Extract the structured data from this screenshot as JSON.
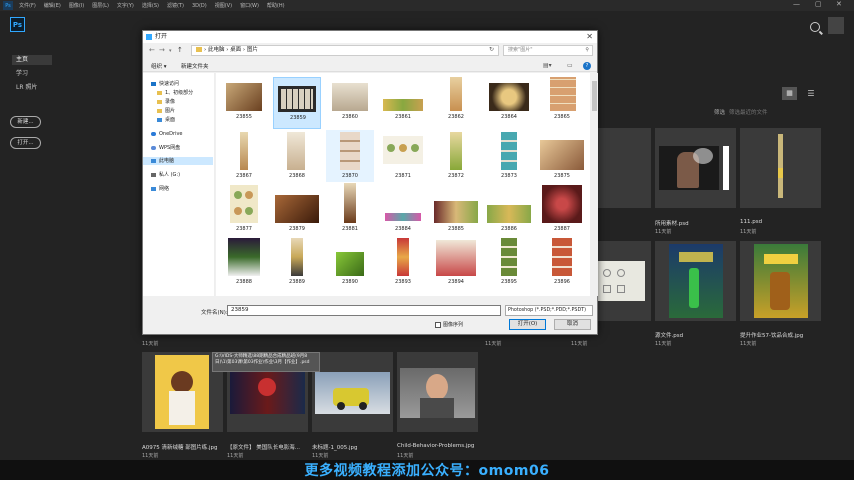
{
  "menubar": {
    "app_icon": "Ps",
    "items": [
      "文件(F)",
      "编辑(E)",
      "图像(I)",
      "图层(L)",
      "文字(Y)",
      "选择(S)",
      "滤镜(T)",
      "3D(D)",
      "视图(V)",
      "窗口(W)",
      "帮助(H)"
    ],
    "minimize": "—",
    "maximize": "▢",
    "close": "✕"
  },
  "sidebar": {
    "logo": "Ps",
    "nav": [
      {
        "label": "主页"
      },
      {
        "label": "学习"
      },
      {
        "label": "LR 照片"
      }
    ],
    "new_button": "新建...",
    "open_button": "打开..."
  },
  "home": {
    "filter_label": "筛选",
    "filter_placeholder": "筛选最近的文件",
    "grid_view_icon": "grid-icon",
    "list_view_icon": "list-icon",
    "search_icon": "search-icon"
  },
  "recent_files": [
    {
      "name": "所用素材.psd",
      "time": "11天前"
    },
    {
      "name": "111.psd",
      "time": "11天前"
    },
    {
      "name": "源文件.psd",
      "time": "11天前"
    },
    {
      "name": "提升作业57-饮品合成.jpg",
      "time": "11天前"
    },
    {
      "name": "",
      "time": "11天前"
    },
    {
      "name": "",
      "time": "11天前"
    },
    {
      "name": "",
      "time": "11天前"
    },
    {
      "name": "A0975 清新绒糖 部图片练.jpg",
      "time": "11天前"
    },
    {
      "name": "【原文件】 美国队长电影海...",
      "time": "11天前"
    },
    {
      "name": "未标题-1_005.jpg",
      "time": "11天前"
    },
    {
      "name": "Child-Behavior-Problems.jpg",
      "time": "11天前"
    }
  ],
  "tooltip": "G:\\VIDS-大师精选\\88期精品合成精品班(9月8日)\\1\\第03课\\第03作业\\作业\\3月【作业】.psd",
  "dialog": {
    "title": "打开",
    "close": "✕",
    "breadcrumb": "› 此电脑 › 桌面 › 图片",
    "search_placeholder": "搜索\"图片\"",
    "organize": "组织 ▾",
    "new_folder": "新建文件夹",
    "nav_pane": [
      {
        "label": "快速访问"
      },
      {
        "label": "1、初级部分"
      },
      {
        "label": "录像"
      },
      {
        "label": "图片"
      },
      {
        "label": "桌面"
      },
      {
        "label": "OneDrive"
      },
      {
        "label": "WPS网盘"
      },
      {
        "label": "此电脑"
      },
      {
        "label": "私人 (G:)"
      },
      {
        "label": "网络"
      }
    ],
    "files": [
      "23855",
      "23859",
      "23860",
      "23861",
      "23862",
      "23864",
      "23865",
      "23867",
      "23868",
      "23870",
      "23871",
      "23872",
      "23873",
      "23875",
      "23877",
      "23879",
      "23881",
      "23884",
      "23885",
      "23886",
      "23887",
      "23888",
      "23889",
      "23890",
      "23893",
      "23894",
      "23895",
      "23896"
    ],
    "filename_label": "文件名(N):",
    "filename_value": "23859",
    "filetype": "Photoshop (*.PSD;*.PDD;*.PSDT)",
    "sequence_label": "图像序列",
    "open_button": "打开(O)",
    "cancel_button": "取消"
  },
  "banner": "更多视频教程添加公众号：omom06"
}
